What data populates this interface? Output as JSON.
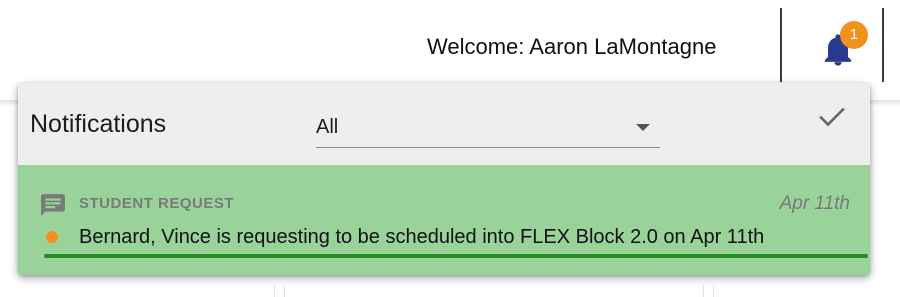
{
  "header": {
    "welcome_text": "Welcome: Aaron LaMontagne",
    "notification_count": "1"
  },
  "notifications_panel": {
    "title": "Notifications",
    "filter": {
      "selected": "All"
    },
    "items": [
      {
        "type": "STUDENT REQUEST",
        "date": "Apr 11th",
        "message": "Bernard, Vince is requesting to be scheduled into FLEX Block 2.0 on Apr 11th",
        "unread": true
      }
    ]
  },
  "colors": {
    "accent_orange": "#f2921c",
    "bell_blue": "#2a3b8f",
    "item_highlight_green": "#99d39a",
    "underline_green": "#1f8f1f"
  },
  "icons": {
    "bell": "bell-icon",
    "check": "check-icon",
    "chat": "chat-bubble-icon",
    "caret": "caret-down-icon"
  }
}
